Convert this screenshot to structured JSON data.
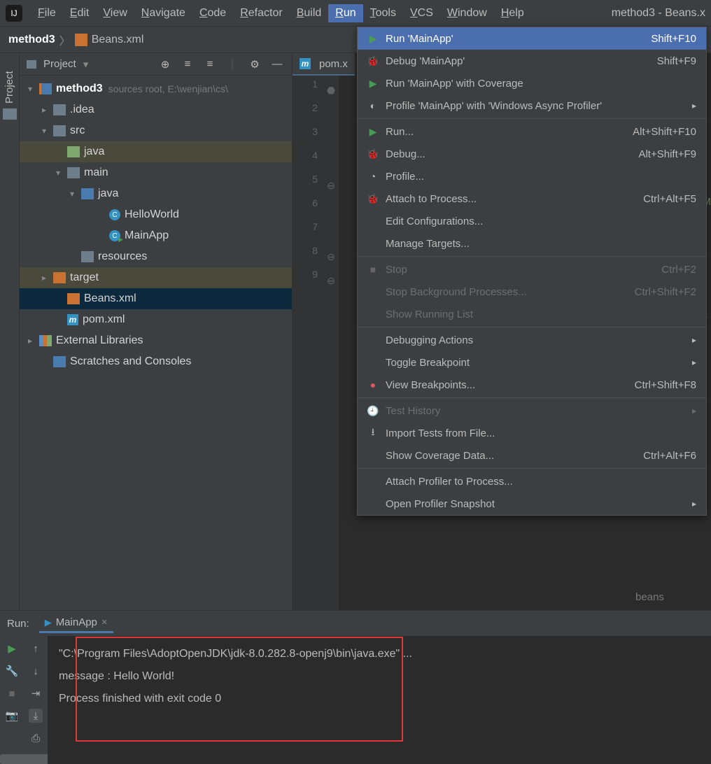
{
  "menubar": {
    "items": [
      "File",
      "Edit",
      "View",
      "Navigate",
      "Code",
      "Refactor",
      "Build",
      "Run",
      "Tools",
      "VCS",
      "Window",
      "Help"
    ],
    "active_index": 7,
    "title": "method3 - Beans.x"
  },
  "breadcrumb": {
    "project": "method3",
    "file": "Beans.xml"
  },
  "project": {
    "header_label": "Project",
    "root": {
      "name": "method3",
      "hint": "sources root,  E:\\wenjian\\cs\\"
    },
    "nodes": [
      {
        "level": 1,
        "arrow": "down",
        "icon": "module",
        "text": "method3",
        "bold": true,
        "hint": "sources root,  E:\\wenjian\\cs\\"
      },
      {
        "level": 2,
        "arrow": "right",
        "icon": "folder",
        "text": ".idea"
      },
      {
        "level": 2,
        "arrow": "down",
        "icon": "folder",
        "text": "src"
      },
      {
        "level": 3,
        "arrow": "",
        "icon": "folder-green",
        "text": "java",
        "row_class": "tgt"
      },
      {
        "level": 3,
        "arrow": "down",
        "icon": "folder",
        "text": "main"
      },
      {
        "level": 4,
        "arrow": "down",
        "icon": "folder-blue",
        "text": "java"
      },
      {
        "level": 6,
        "arrow": "",
        "icon": "class",
        "text": "HelloWorld"
      },
      {
        "level": 6,
        "arrow": "",
        "icon": "class-run",
        "text": "MainApp"
      },
      {
        "level": 4,
        "arrow": "",
        "icon": "folder",
        "text": "resources"
      },
      {
        "level": 2,
        "arrow": "right",
        "icon": "folder-orange",
        "text": "target",
        "row_class": "tgt"
      },
      {
        "level": 3,
        "arrow": "",
        "icon": "xml",
        "text": "Beans.xml",
        "row_class": "sel"
      },
      {
        "level": 3,
        "arrow": "",
        "icon": "m",
        "text": "pom.xml"
      },
      {
        "level": 1,
        "arrow": "right",
        "icon": "lib",
        "text": "External Libraries"
      },
      {
        "level": 2,
        "arrow": "",
        "icon": "folder-blue",
        "text": "Scratches and Consoles"
      }
    ]
  },
  "editor": {
    "tab_label": "pom.x",
    "line_numbers": [
      "1",
      "2",
      "3",
      "4",
      "5",
      "6",
      "7",
      "8",
      "9"
    ],
    "hint": "beans"
  },
  "run_menu": {
    "items": [
      {
        "icon": "play",
        "text": "Run 'MainApp'",
        "shortcut": "Shift+F10",
        "hl": true
      },
      {
        "icon": "bug",
        "text": "Debug 'MainApp'",
        "shortcut": "Shift+F9"
      },
      {
        "icon": "play-shield",
        "text": "Run 'MainApp' with Coverage",
        "shortcut": ""
      },
      {
        "icon": "clock",
        "text": "Profile 'MainApp' with 'Windows Async Profiler'",
        "shortcut": "",
        "submenu": true
      },
      {
        "sep": true
      },
      {
        "icon": "play",
        "text": "Run...",
        "shortcut": "Alt+Shift+F10"
      },
      {
        "icon": "bug",
        "text": "Debug...",
        "shortcut": "Alt+Shift+F9"
      },
      {
        "icon": "gauge",
        "text": "Profile...",
        "shortcut": ""
      },
      {
        "icon": "bug-green",
        "text": "Attach to Process...",
        "shortcut": "Ctrl+Alt+F5"
      },
      {
        "icon": "",
        "text": "Edit Configurations...",
        "shortcut": ""
      },
      {
        "icon": "",
        "text": "Manage Targets...",
        "shortcut": ""
      },
      {
        "sep": true
      },
      {
        "icon": "stop",
        "text": "Stop",
        "shortcut": "Ctrl+F2",
        "disabled": true
      },
      {
        "icon": "",
        "text": "Stop Background Processes...",
        "shortcut": "Ctrl+Shift+F2",
        "disabled": true
      },
      {
        "icon": "",
        "text": "Show Running List",
        "shortcut": "",
        "disabled": true
      },
      {
        "sep": true
      },
      {
        "icon": "",
        "text": "Debugging Actions",
        "shortcut": "",
        "submenu": true
      },
      {
        "icon": "",
        "text": "Toggle Breakpoint",
        "shortcut": "",
        "submenu": true
      },
      {
        "icon": "dot-red",
        "text": "View Breakpoints...",
        "shortcut": "Ctrl+Shift+F8"
      },
      {
        "sep": true
      },
      {
        "icon": "clock-grey",
        "text": "Test History",
        "shortcut": "",
        "submenu": true,
        "disabled": true
      },
      {
        "icon": "import",
        "text": "Import Tests from File...",
        "shortcut": ""
      },
      {
        "icon": "",
        "text": "Show Coverage Data...",
        "shortcut": "Ctrl+Alt+F6"
      },
      {
        "sep": true
      },
      {
        "icon": "",
        "text": "Attach Profiler to Process...",
        "shortcut": ""
      },
      {
        "icon": "",
        "text": "Open Profiler Snapshot",
        "shortcut": "",
        "submenu": true
      }
    ]
  },
  "run_panel": {
    "label": "Run:",
    "tab": "MainApp",
    "console": {
      "cmd": "\"C:\\Program Files\\AdoptOpenJDK\\jdk-8.0.282.8-openj9\\bin\\java.exe\" ...",
      "line1": "message : Hello World!",
      "line2": "",
      "line3": "Process finished with exit code 0"
    }
  }
}
